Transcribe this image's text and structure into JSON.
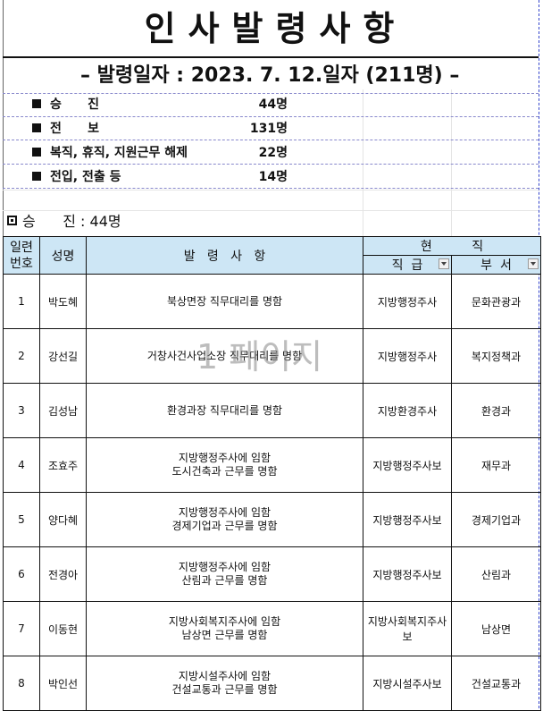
{
  "document": {
    "title": "인사발령사항",
    "date_line": "– 발령일자 : 2023. 7. 12.일자 (211명) –",
    "watermark": "1 페이지"
  },
  "summary": [
    {
      "label": "승      진",
      "count": "44명"
    },
    {
      "label": "전      보",
      "count": "131명"
    },
    {
      "label": "복직, 휴직, 지원근무 해제",
      "count": "22명"
    },
    {
      "label": "전입, 전출 등",
      "count": "14명"
    }
  ],
  "section": {
    "title": "승      진 : 44명"
  },
  "table": {
    "headers": {
      "no": "일련번호",
      "name": "성명",
      "action": "발   령   사   항",
      "current": "현          직",
      "grade": "직  급",
      "dept": "부  서"
    },
    "rows": [
      {
        "no": "1",
        "name": "박도혜",
        "action": [
          "북상면장 직무대리를 명함"
        ],
        "grade": "지방행정주사",
        "dept": "문화관광과"
      },
      {
        "no": "2",
        "name": "강선길",
        "action": [
          "거창사건사업소장 직무대리를 명함"
        ],
        "grade": "지방행정주사",
        "dept": "복지정책과"
      },
      {
        "no": "3",
        "name": "김성남",
        "action": [
          "환경과장 직무대리를 명함"
        ],
        "grade": "지방환경주사",
        "dept": "환경과"
      },
      {
        "no": "4",
        "name": "조효주",
        "action": [
          "지방행정주사에 임함",
          "도시건축과 근무를 명함"
        ],
        "grade": "지방행정주사보",
        "dept": "재무과"
      },
      {
        "no": "5",
        "name": "양다혜",
        "action": [
          "지방행정주사에 임함",
          "경제기업과 근무를 명함"
        ],
        "grade": "지방행정주사보",
        "dept": "경제기업과"
      },
      {
        "no": "6",
        "name": "전경아",
        "action": [
          "지방행정주사에 임함",
          "산림과 근무를 명함"
        ],
        "grade": "지방행정주사보",
        "dept": "산림과"
      },
      {
        "no": "7",
        "name": "이동현",
        "action": [
          "지방사회복지주사에 임함",
          "남상면 근무를 명함"
        ],
        "grade": "지방사회복지주사보",
        "dept": "남상면"
      },
      {
        "no": "8",
        "name": "박인선",
        "action": [
          "지방시설주사에 임함",
          "건설교통과 근무를 명함"
        ],
        "grade": "지방시설주사보",
        "dept": "건설교통과"
      }
    ]
  }
}
